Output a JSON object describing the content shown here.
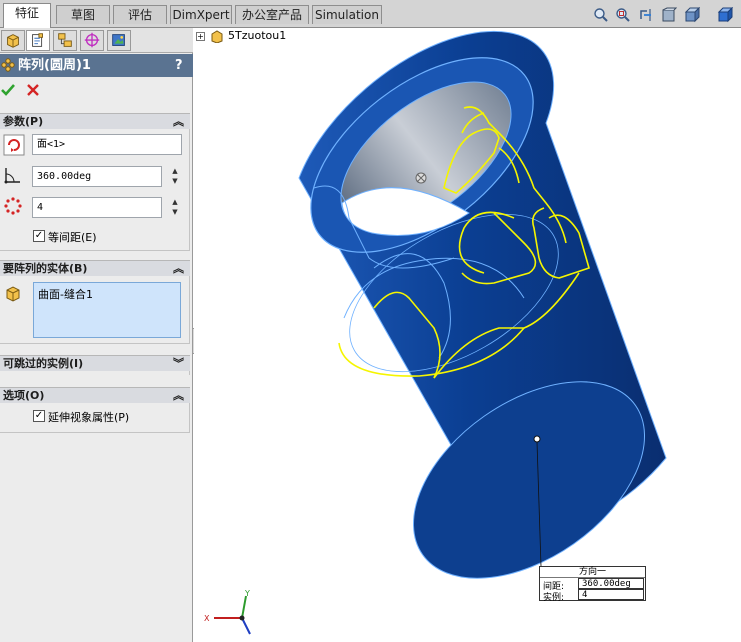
{
  "command_tabs": [
    "特征",
    "草图",
    "评估",
    "DimXpert",
    "办公室产品",
    "Simulation"
  ],
  "view_toolbar_icons": [
    "zoom-to-fit-icon",
    "zoom-area-icon",
    "previous-view-icon",
    "section-view-icon",
    "view-orientation-icon",
    "display-style-icon"
  ],
  "panel": {
    "tabs": [
      "feature-manager-icon",
      "property-manager-icon",
      "configuration-manager-icon",
      "dimxpert-icon",
      "display-manager-icon"
    ],
    "title": "阵列(圆周)1",
    "help": "?",
    "ok_icon": "checkmark-icon",
    "cancel_icon": "x-icon",
    "params": {
      "header": "参数(P)",
      "axis_value": "面<1>",
      "angle_value": "360.00deg",
      "count_value": "4",
      "equal_spacing_label": "等间距(E)",
      "equal_spacing_checked": true
    },
    "bodies": {
      "header": "要阵列的实体(B)",
      "items": [
        "曲面-缝合1"
      ]
    },
    "skip": {
      "header": "可跳过的实例(I)"
    },
    "options": {
      "header": "选项(O)",
      "propagate_label": "延伸视象属性(P)",
      "propagate_checked": true
    }
  },
  "viewport": {
    "tree_root": "5Tzuotou1",
    "callout": {
      "title": "方向一",
      "spacing_label": "间距:",
      "spacing_value": "360.00deg",
      "instances_label": "实例:",
      "instances_value": "4"
    },
    "triad": {
      "x": "X",
      "y": "Y"
    },
    "colors": {
      "body": "#0a3e8c",
      "edge": "#6fb1ff",
      "preview": "#f5f500"
    }
  }
}
